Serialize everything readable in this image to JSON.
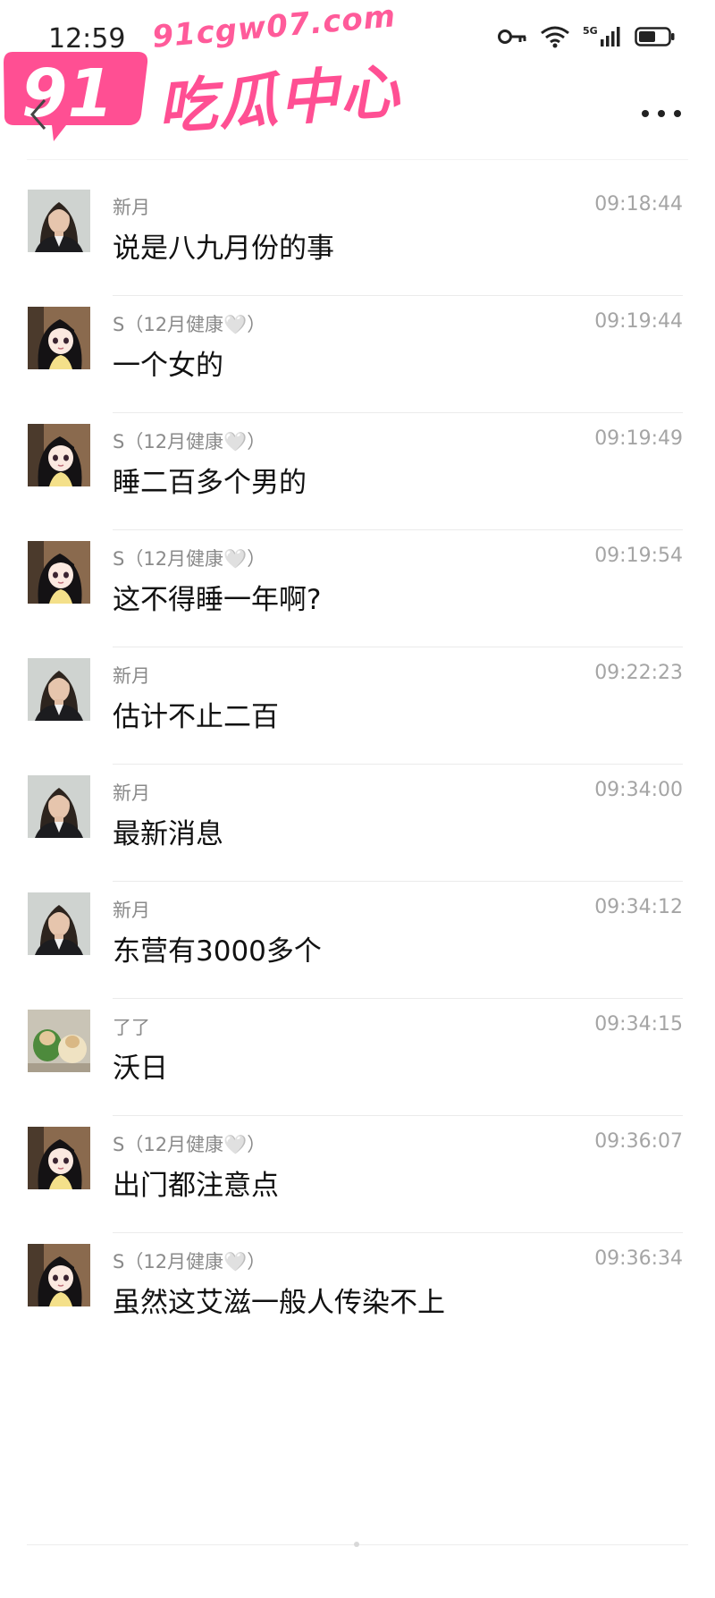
{
  "status_bar": {
    "time": "12:59",
    "network": "5G"
  },
  "watermark": {
    "badge": "91",
    "domain": "91cgw07.com",
    "title": "吃瓜中心"
  },
  "messages": [
    {
      "name": "新月",
      "time": "09:18:44",
      "text": "说是八九月份的事",
      "avatar": "woman-photo"
    },
    {
      "name": "S（12月健康🤍）",
      "time": "09:19:44",
      "text": "一个女的",
      "avatar": "anime-girl"
    },
    {
      "name": "S（12月健康🤍）",
      "time": "09:19:49",
      "text": "睡二百多个男的",
      "avatar": "anime-girl"
    },
    {
      "name": "S（12月健康🤍）",
      "time": "09:19:54",
      "text": "这不得睡一年啊?",
      "avatar": "anime-girl"
    },
    {
      "name": "新月",
      "time": "09:22:23",
      "text": "估计不止二百",
      "avatar": "woman-photo"
    },
    {
      "name": "新月",
      "time": "09:34:00",
      "text": "最新消息",
      "avatar": "woman-photo"
    },
    {
      "name": "新月",
      "time": "09:34:12",
      "text": "东营有3000多个",
      "avatar": "woman-photo"
    },
    {
      "name": "了了",
      "time": "09:34:15",
      "text": "沃日",
      "avatar": "dogs-photo"
    },
    {
      "name": "S（12月健康🤍）",
      "time": "09:36:07",
      "text": "出门都注意点",
      "avatar": "anime-girl"
    },
    {
      "name": "S（12月健康🤍）",
      "time": "09:36:34",
      "text": "虽然这艾滋一般人传染不上",
      "avatar": "anime-girl"
    }
  ]
}
